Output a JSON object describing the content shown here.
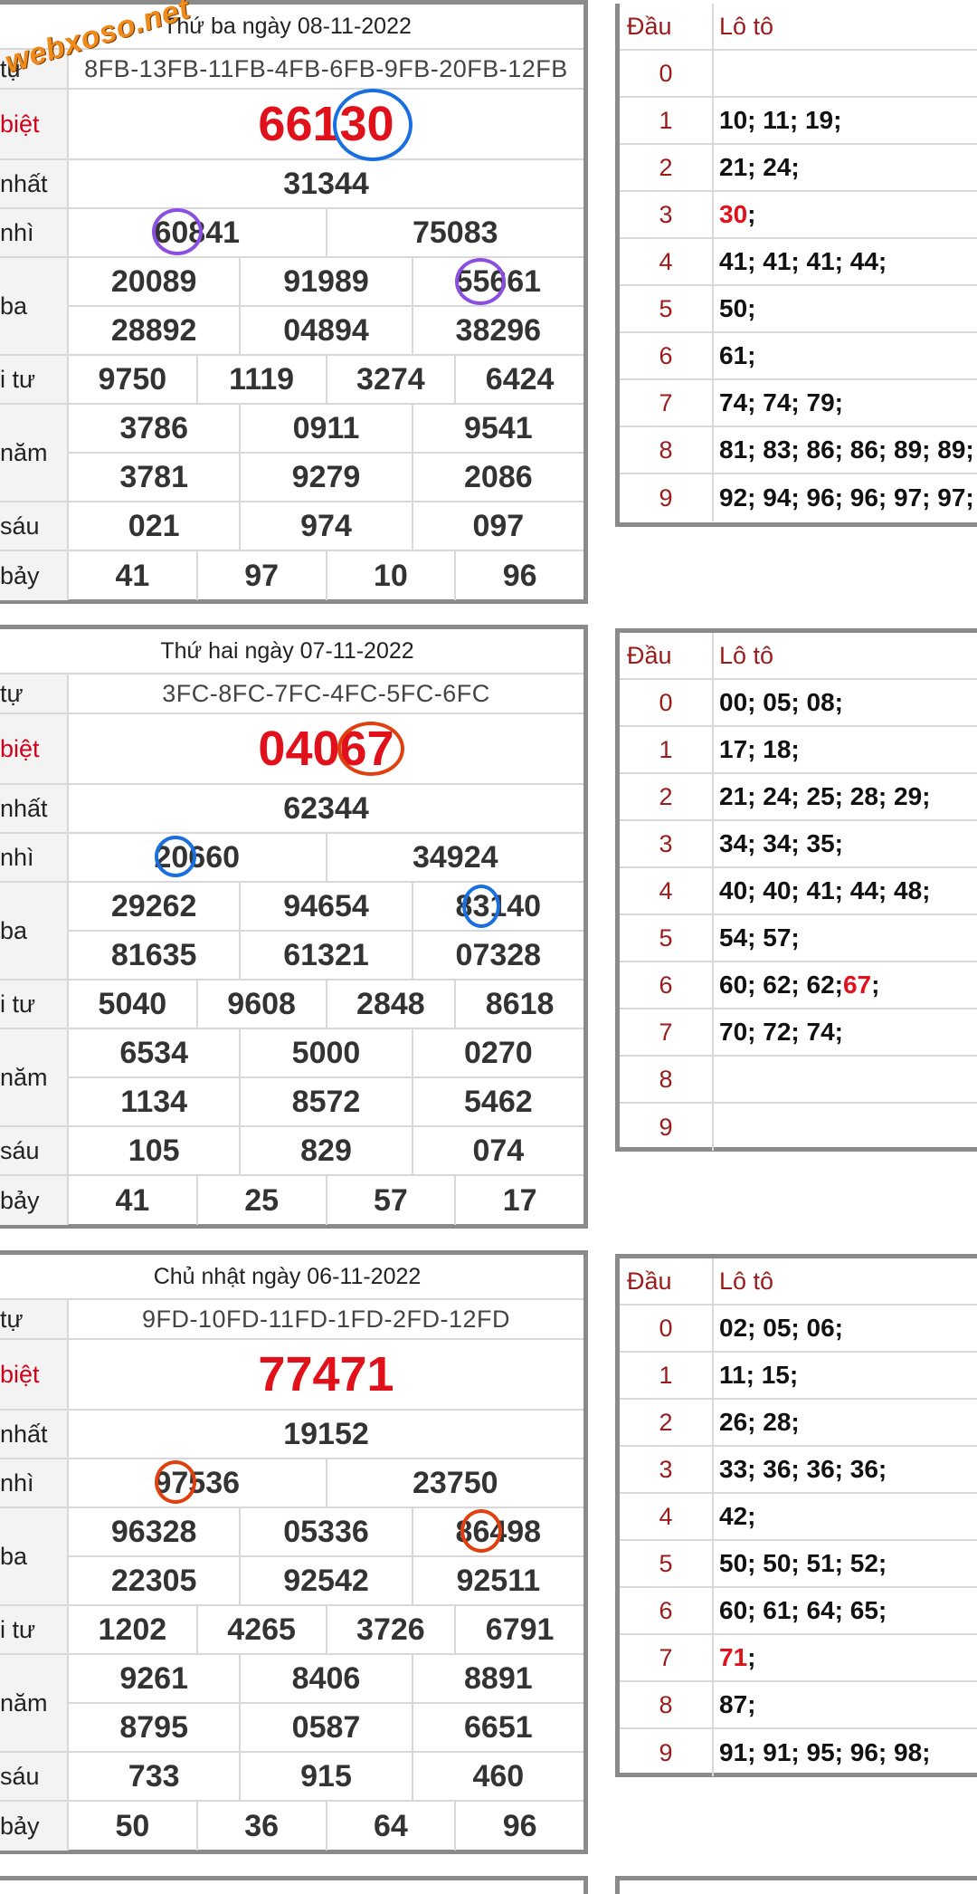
{
  "watermark": "webxoso.net",
  "labels": {
    "ky_hieu": "tự",
    "dac_biet": "biệt",
    "nhat": "nhất",
    "nhi": "nhì",
    "ba": "ba",
    "tu": "i tư",
    "nam": "năm",
    "sau": "sáu",
    "bay": "bảy"
  },
  "loto_head": {
    "dau": "Đầu",
    "loto": "Lô tô"
  },
  "draws": [
    {
      "date": "Thứ ba ngày 08-11-2022",
      "code": "8FB-13FB-11FB-4FB-6FB-9FB-20FB-12FB",
      "special": "66130",
      "first": "31344",
      "second": [
        "60841",
        "75083"
      ],
      "third": [
        "20089",
        "91989",
        "55661",
        "28892",
        "04894",
        "38296"
      ],
      "fourth": [
        "9750",
        "1119",
        "3274",
        "6424"
      ],
      "fifth": [
        "3786",
        "0911",
        "9541",
        "3781",
        "9279",
        "2086"
      ],
      "sixth": [
        "021",
        "974",
        "097"
      ],
      "seventh": [
        "41",
        "97",
        "10",
        "96"
      ],
      "loto": [
        {
          "dau": "0",
          "pre": "",
          "hl": "",
          "post": ""
        },
        {
          "dau": "1",
          "pre": "10; 11; 19;",
          "hl": "",
          "post": ""
        },
        {
          "dau": "2",
          "pre": "21; 24;",
          "hl": "",
          "post": ""
        },
        {
          "dau": "3",
          "pre": "",
          "hl": "30",
          "post": ";"
        },
        {
          "dau": "4",
          "pre": "41; 41; 41; 44;",
          "hl": "",
          "post": ""
        },
        {
          "dau": "5",
          "pre": "50;",
          "hl": "",
          "post": ""
        },
        {
          "dau": "6",
          "pre": "61;",
          "hl": "",
          "post": ""
        },
        {
          "dau": "7",
          "pre": "74; 74; 79;",
          "hl": "",
          "post": ""
        },
        {
          "dau": "8",
          "pre": "81; 83; 86; 86; 89; 89;",
          "hl": "",
          "post": ""
        },
        {
          "dau": "9",
          "pre": "92; 94; 96; 96; 97; 97;",
          "hl": "",
          "post": ""
        }
      ]
    },
    {
      "date": "Thứ hai ngày 07-11-2022",
      "code": "3FC-8FC-7FC-4FC-5FC-6FC",
      "special": "04067",
      "first": "62344",
      "second": [
        "20660",
        "34924"
      ],
      "third": [
        "29262",
        "94654",
        "83140",
        "81635",
        "61321",
        "07328"
      ],
      "fourth": [
        "5040",
        "9608",
        "2848",
        "8618"
      ],
      "fifth": [
        "6534",
        "5000",
        "0270",
        "1134",
        "8572",
        "5462"
      ],
      "sixth": [
        "105",
        "829",
        "074"
      ],
      "seventh": [
        "41",
        "25",
        "57",
        "17"
      ],
      "loto": [
        {
          "dau": "0",
          "pre": "00; 05; 08;",
          "hl": "",
          "post": ""
        },
        {
          "dau": "1",
          "pre": "17; 18;",
          "hl": "",
          "post": ""
        },
        {
          "dau": "2",
          "pre": "21; 24; 25; 28; 29;",
          "hl": "",
          "post": ""
        },
        {
          "dau": "3",
          "pre": "34; 34; 35;",
          "hl": "",
          "post": ""
        },
        {
          "dau": "4",
          "pre": "40; 40; 41; 44; 48;",
          "hl": "",
          "post": ""
        },
        {
          "dau": "5",
          "pre": "54; 57;",
          "hl": "",
          "post": ""
        },
        {
          "dau": "6",
          "pre": "60; 62; 62; ",
          "hl": "67",
          "post": ";"
        },
        {
          "dau": "7",
          "pre": "70; 72; 74;",
          "hl": "",
          "post": ""
        },
        {
          "dau": "8",
          "pre": "",
          "hl": "",
          "post": ""
        },
        {
          "dau": "9",
          "pre": "",
          "hl": "",
          "post": ""
        }
      ]
    },
    {
      "date": "Chủ nhật ngày 06-11-2022",
      "code": "9FD-10FD-11FD-1FD-2FD-12FD",
      "special": "77471",
      "first": "19152",
      "second": [
        "97536",
        "23750"
      ],
      "third": [
        "96328",
        "05336",
        "86498",
        "22305",
        "92542",
        "92511"
      ],
      "fourth": [
        "1202",
        "4265",
        "3726",
        "6791"
      ],
      "fifth": [
        "9261",
        "8406",
        "8891",
        "8795",
        "0587",
        "6651"
      ],
      "sixth": [
        "733",
        "915",
        "460"
      ],
      "seventh": [
        "50",
        "36",
        "64",
        "96"
      ],
      "loto": [
        {
          "dau": "0",
          "pre": "02; 05; 06;",
          "hl": "",
          "post": ""
        },
        {
          "dau": "1",
          "pre": "11; 15;",
          "hl": "",
          "post": ""
        },
        {
          "dau": "2",
          "pre": "26; 28;",
          "hl": "",
          "post": ""
        },
        {
          "dau": "3",
          "pre": "33; 36; 36; 36;",
          "hl": "",
          "post": ""
        },
        {
          "dau": "4",
          "pre": "42;",
          "hl": "",
          "post": ""
        },
        {
          "dau": "5",
          "pre": "50; 50; 51; 52;",
          "hl": "",
          "post": ""
        },
        {
          "dau": "6",
          "pre": "60; 61; 64; 65;",
          "hl": "",
          "post": ""
        },
        {
          "dau": "7",
          "pre": "",
          "hl": "71",
          "post": ";"
        },
        {
          "dau": "8",
          "pre": "87;",
          "hl": "",
          "post": ""
        },
        {
          "dau": "9",
          "pre": "91; 91; 95; 96; 98;",
          "hl": "",
          "post": ""
        }
      ]
    }
  ],
  "colors": {
    "special_red": "#e0111b",
    "dau_red": "#9b1b1b",
    "ring_blue": "#1a6fe0",
    "ring_purple": "#8a4fe0",
    "ring_red": "#e04010",
    "watermark_orange": "#f08a1a"
  }
}
